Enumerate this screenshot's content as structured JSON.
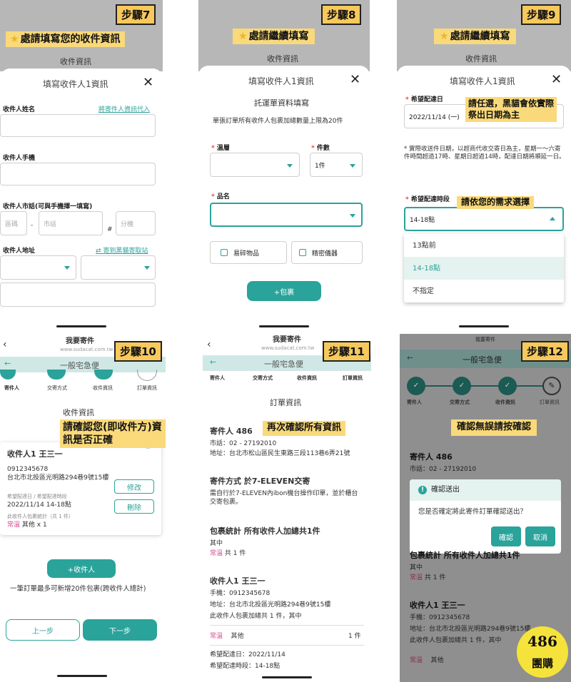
{
  "p7": {
    "step": "步驟7",
    "highlight": "處請填寫您的收件資訊",
    "sheet_title": "填寫收件人1資訊",
    "top_label": "收件資訊",
    "name_label": "收件人姓名",
    "name_link": "將寄件人資訊代入",
    "phone_label": "收件人手機",
    "tel_label": "收件人市話(可與手機擇一填寫)",
    "area_ph": "區碼",
    "tel_ph": "市話",
    "ext_ph": "分機",
    "addr_label": "收件人地址",
    "addr_link": "寄到黑貓寄取站"
  },
  "p8": {
    "step": "步驟8",
    "highlight": "處請繼續填寫",
    "top_label": "收件資訊",
    "sheet_title": "填寫收件人1資訊",
    "subtitle": "託運單資料填寫",
    "note": "單張訂單所有收件人包裹加總數量上限為20件",
    "temp_label": "溫層",
    "count_label": "件數",
    "count_val": "1件",
    "item_label": "品名",
    "fragile": "易碎物品",
    "precision": "精密儀器",
    "add_btn": "+包裹"
  },
  "p9": {
    "step": "步驟9",
    "highlight": "處請繼續填寫",
    "top_label": "收件資訊",
    "sheet_title": "填寫收件人1資訊",
    "date_label": "希望配達日",
    "date_val": "2022/11/14 (一)",
    "hl_date": "請任選，黑貓會依實際祭出日期為主",
    "note": "實際收送件日期，以超商代收交寄日為主，星期一～六寄件時間超過17時、星期日超過14時，配達日期將順延一日。",
    "time_label": "希望配達時段",
    "hl_time": "請依您的需求選擇",
    "time_val": "14-18點",
    "options": [
      "13點前",
      "14-18點",
      "不指定"
    ]
  },
  "p10": {
    "step": "步驟10",
    "header": "我要寄件",
    "url": "www.sudacat.com.tw",
    "nav_title": "一般宅急便",
    "steps": [
      "寄件人",
      "交寄方式",
      "收件資訊",
      "訂單資訊"
    ],
    "section": "收件資訊",
    "hl": "請確認您(即收件方)資訊是否正確",
    "recipient": "收件人1 王三一",
    "phone": "0912345678",
    "addr": "台北市北投區光明路294巷9號15樓",
    "date_lbl": "希望配達日 / 希望配達時段",
    "date_val": "2022/11/14 14-18點",
    "stat_lbl": "此收件人包裹統計（共 1 件）",
    "temp": "常溫",
    "item": "其他 x 1",
    "edit": "修改",
    "del": "刪除",
    "add": "+收件人",
    "limit": "一筆訂單最多可新增20件包裹(跨收件人總計)",
    "prev": "上一步",
    "next": "下一步"
  },
  "p11": {
    "step": "步驟11",
    "header": "我要寄件",
    "url": "www.sudacat.com.tw",
    "nav_title": "一般宅急便",
    "steps": [
      "寄件人",
      "交寄方式",
      "收件資訊",
      "訂單資訊"
    ],
    "section": "訂單資訊",
    "hl": "再次確認所有資訊",
    "sender": "寄件人 486",
    "tel": "市話：02 - 27192010",
    "addr": "地址：台北市松山區民生東路三段113巷6弄21號",
    "method": "寄件方式 於7-ELEVEN交寄",
    "method_note": "需自行於7-ELEVEN內ibon機台操作印單，並於櫃台交寄包裹。",
    "stat": "包裹統計 所有收件人加總共1件",
    "stat_sub": "其中",
    "temp": "常溫",
    "stat_cnt": "共 1 件",
    "rcpt": "收件人1 王三一",
    "rphone": "手機：0912345678",
    "raddr": "地址：台北市北投區光明路294巷9號15樓",
    "rstat": "此收件人包裹加總共 1 件，其中",
    "row_item": "其他",
    "row_cnt": "1 件",
    "rdate": "希望配達日：2022/11/14",
    "rtime": "希望配達時段：14-18點"
  },
  "p12": {
    "step": "步驟12",
    "header": "我要寄件",
    "nav_title": "一般宅急便",
    "steps": [
      "寄件人",
      "交寄方式",
      "收件資訊",
      "訂單資訊"
    ],
    "hl": "確認無誤請按確認",
    "sender": "寄件人 486",
    "tel": "市話：02 - 27192010",
    "dlg_title": "確認送出",
    "dlg_msg": "您是否確定將此寄件訂單確認送出？",
    "ok": "確認",
    "cancel": "取消",
    "stat": "包裹統計 所有收件人加總共1件",
    "stat_sub": "其中",
    "temp": "常溫",
    "stat_cnt": "共 1 件",
    "rcpt": "收件人1 王三一",
    "rphone": "手機：0912345678",
    "raddr": "地址：台北市北投區光明路294巷9號15樓",
    "rstat": "此收件人包裹加總共 1 件，其中",
    "temp2": "常溫",
    "item2": "其他"
  },
  "logo": {
    "top": "486",
    "bottom": "團購"
  },
  "colors": {
    "teal": "#2aa39a",
    "highlight": "#f9d97a",
    "step_bg": "#f7c95c"
  }
}
